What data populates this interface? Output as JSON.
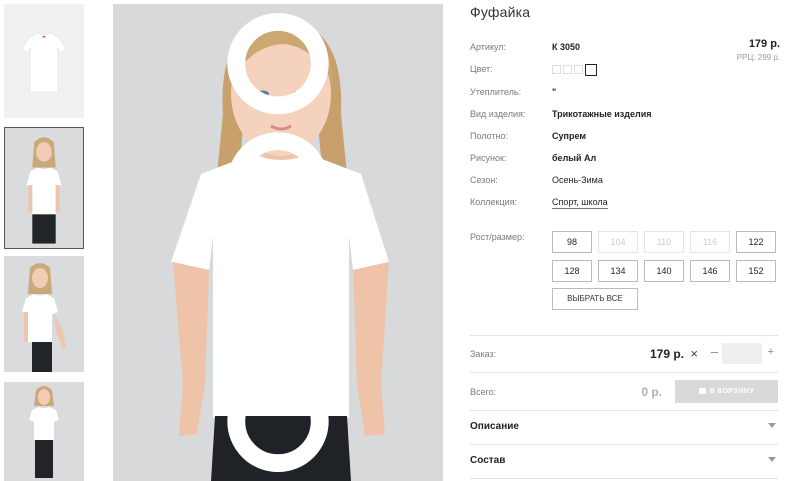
{
  "product": {
    "title": "Фуфайка",
    "price": "179 р.",
    "rrc": "РРЦ: 299 р."
  },
  "specs": [
    {
      "label": "Артикул:",
      "value": "К 3050"
    },
    {
      "label": "Цвет:",
      "value": ""
    },
    {
      "label": "Утеплитель:",
      "value": "\""
    },
    {
      "label": "Вид изделия:",
      "value": "Трикотажные изделия"
    },
    {
      "label": "Полотно:",
      "value": "Супрем"
    },
    {
      "label": "Рисунок:",
      "value": "белый Ал"
    },
    {
      "label": "Сезон:",
      "value": "Осень-Зима"
    },
    {
      "label": "Коллекция:",
      "value": "Спорт, школа"
    }
  ],
  "swatch_count": 4,
  "sizes": {
    "label": "Рост/размер:",
    "options": [
      {
        "value": "98",
        "available": true
      },
      {
        "value": "104",
        "available": false
      },
      {
        "value": "110",
        "available": false
      },
      {
        "value": "116",
        "available": false
      },
      {
        "value": "122",
        "available": true
      },
      {
        "value": "128",
        "available": true
      },
      {
        "value": "134",
        "available": true
      },
      {
        "value": "140",
        "available": true
      },
      {
        "value": "146",
        "available": true
      },
      {
        "value": "152",
        "available": true
      }
    ],
    "select_all": "ВЫБРАТЬ ВСЕ"
  },
  "order": {
    "label": "Заказ:",
    "price": "179 р.",
    "times": "×",
    "minus": "–",
    "plus": "+",
    "quantity": ""
  },
  "total": {
    "label": "Всего:",
    "value": "0 р.",
    "cart_button": "В КОРЗИНУ"
  },
  "accordion": [
    {
      "title": "Описание"
    },
    {
      "title": "Состав"
    }
  ],
  "colors": {
    "photo_bg": "#d7d9da",
    "accent": "#222222",
    "muted": "#7a7a7a",
    "button_disabled": "#d9d9d9"
  }
}
